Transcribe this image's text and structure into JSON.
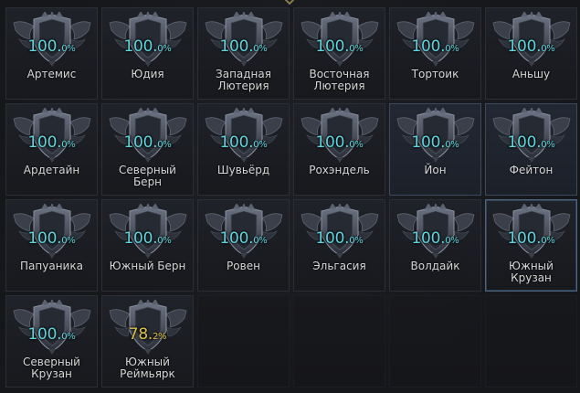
{
  "colors": {
    "complete": "#5fd4dc",
    "partial": "#d9c24a",
    "label": "#d6d6d6"
  },
  "tiles": [
    {
      "pct_main": "100.",
      "pct_frac": "0%",
      "name": "Артемис",
      "state": "normal",
      "progress": 100.0
    },
    {
      "pct_main": "100.",
      "pct_frac": "0%",
      "name": "Юдия",
      "state": "normal",
      "progress": 100.0
    },
    {
      "pct_main": "100.",
      "pct_frac": "0%",
      "name": "Западная\nЛютерия",
      "state": "normal",
      "progress": 100.0
    },
    {
      "pct_main": "100.",
      "pct_frac": "0%",
      "name": "Восточная\nЛютерия",
      "state": "normal",
      "progress": 100.0
    },
    {
      "pct_main": "100.",
      "pct_frac": "0%",
      "name": "Тортоик",
      "state": "normal",
      "progress": 100.0
    },
    {
      "pct_main": "100.",
      "pct_frac": "0%",
      "name": "Аньшу",
      "state": "normal",
      "progress": 100.0
    },
    {
      "pct_main": "100.",
      "pct_frac": "0%",
      "name": "Ардетайн",
      "state": "normal",
      "progress": 100.0
    },
    {
      "pct_main": "100.",
      "pct_frac": "0%",
      "name": "Северный Берн",
      "state": "normal",
      "progress": 100.0
    },
    {
      "pct_main": "100.",
      "pct_frac": "0%",
      "name": "Шувьёрд",
      "state": "normal",
      "progress": 100.0
    },
    {
      "pct_main": "100.",
      "pct_frac": "0%",
      "name": "Рохэндель",
      "state": "normal",
      "progress": 100.0
    },
    {
      "pct_main": "100.",
      "pct_frac": "0%",
      "name": "Йон",
      "state": "highlight",
      "progress": 100.0
    },
    {
      "pct_main": "100.",
      "pct_frac": "0%",
      "name": "Фейтон",
      "state": "highlight",
      "progress": 100.0
    },
    {
      "pct_main": "100.",
      "pct_frac": "0%",
      "name": "Папуаника",
      "state": "normal",
      "progress": 100.0
    },
    {
      "pct_main": "100.",
      "pct_frac": "0%",
      "name": "Южный Берн",
      "state": "normal",
      "progress": 100.0
    },
    {
      "pct_main": "100.",
      "pct_frac": "0%",
      "name": "Ровен",
      "state": "normal",
      "progress": 100.0
    },
    {
      "pct_main": "100.",
      "pct_frac": "0%",
      "name": "Эльгасия",
      "state": "normal",
      "progress": 100.0
    },
    {
      "pct_main": "100.",
      "pct_frac": "0%",
      "name": "Волдайк",
      "state": "normal",
      "progress": 100.0
    },
    {
      "pct_main": "100.",
      "pct_frac": "0%",
      "name": "Южный Крузан",
      "state": "selected",
      "progress": 100.0
    },
    {
      "pct_main": "100.",
      "pct_frac": "0%",
      "name": "Северный\nКрузан",
      "state": "normal",
      "progress": 100.0
    },
    {
      "pct_main": "78.",
      "pct_frac": "2%",
      "name": "Южный\nРеймьярк",
      "state": "normal",
      "progress": 78.2
    }
  ],
  "empty_slots": 4
}
